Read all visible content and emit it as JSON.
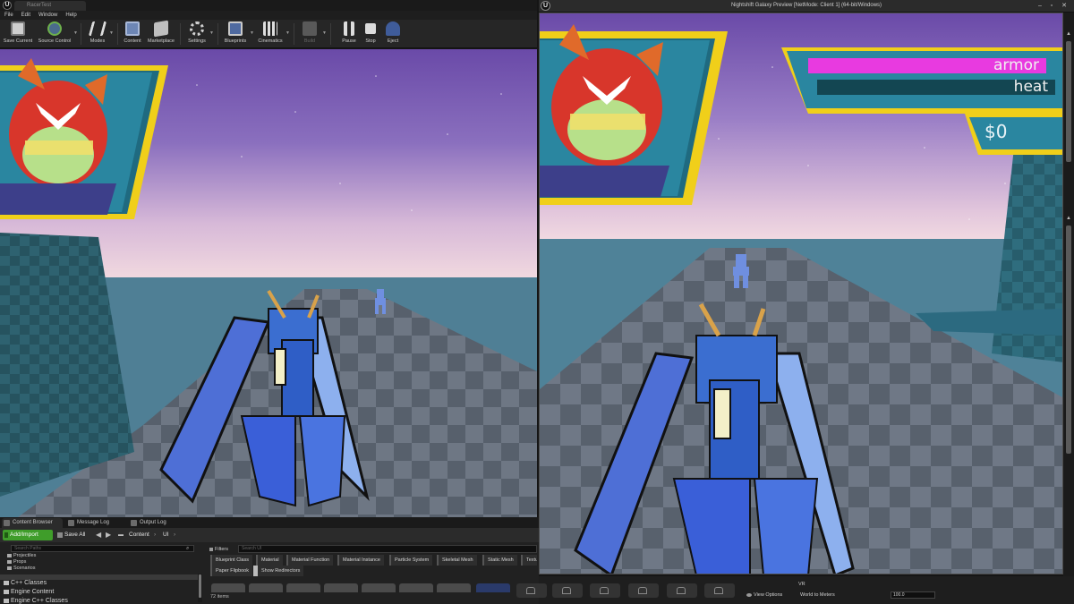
{
  "editor": {
    "tab_title": "RacerTest",
    "logo_glyph": "U",
    "menu": [
      "File",
      "Edit",
      "Window",
      "Help"
    ],
    "toolbar": [
      {
        "label": "Save Current",
        "icon": "save-icon"
      },
      {
        "label": "Source Control",
        "icon": "source-control-icon"
      },
      {
        "label": "Modes",
        "icon": "modes-icon"
      },
      {
        "label": "Content",
        "icon": "content-icon"
      },
      {
        "label": "Marketplace",
        "icon": "marketplace-icon"
      },
      {
        "label": "Settings",
        "icon": "settings-icon"
      },
      {
        "label": "Blueprints",
        "icon": "blueprints-icon"
      },
      {
        "label": "Cinematics",
        "icon": "cinematics-icon"
      },
      {
        "label": "Build",
        "icon": "build-icon"
      },
      {
        "label": "Pause",
        "icon": "pause-icon"
      },
      {
        "label": "Stop",
        "icon": "stop-icon"
      },
      {
        "label": "Eject",
        "icon": "eject-icon"
      }
    ]
  },
  "preview_window": {
    "title": "Nightshift Galaxy Preview [NetMode: Client 1]  (64-bit/Windows)",
    "controls": [
      "–",
      "▫",
      "✕"
    ]
  },
  "hud": {
    "armor_label": "armor",
    "heat_label": "heat",
    "money": "$0",
    "armor_color": "#e83ae0",
    "heat_color": "#134652",
    "frame_color": "#f3d31b"
  },
  "content_browser": {
    "tabs": [
      "Content Browser",
      "Message Log",
      "Output Log"
    ],
    "add_import": "Add/Import",
    "save_all": "Save All",
    "path": [
      "Content",
      "UI"
    ],
    "search_paths_placeholder": "Search Paths",
    "tree": [
      "Projectiles",
      "Props",
      "Scenarios"
    ],
    "categories": [
      "C++ Classes",
      "Engine Content",
      "Engine C++ Classes"
    ],
    "filters_label": "Filters",
    "search_placeholder": "Search UI",
    "filter_chips_row1": [
      "Blueprint Class",
      "Material",
      "Material Function",
      "Material Instance",
      "Particle System",
      "Skeletal Mesh",
      "Static Mesh",
      "Textu"
    ],
    "filter_chips_row2": [
      "Paper Flipbook",
      "Show Redirectors"
    ],
    "item_count": "72 items",
    "view_options": "View Options"
  },
  "details": {
    "vr_label": "VR",
    "world_to_meters_label": "World to Meters",
    "world_to_meters_value": "100.0"
  }
}
